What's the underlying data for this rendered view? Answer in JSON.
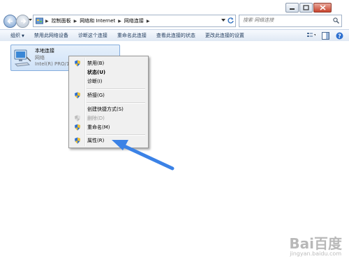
{
  "address_bar": {
    "breadcrumbs": [
      "控制面板",
      "网络和 Internet",
      "网络连接"
    ],
    "search_placeholder": "搜索 网络连接"
  },
  "toolbar": {
    "organize_label": "组织",
    "items": [
      "禁用此网络设备",
      "诊断这个连接",
      "重命名此连接",
      "查看此连接的状态",
      "更改此连接的设置"
    ]
  },
  "connection": {
    "name": "本地连接",
    "status": "网络",
    "device": "Intel(R) PRO/1"
  },
  "context_menu": {
    "items": [
      {
        "label": "禁用(B)",
        "icon": "shield-icon"
      },
      {
        "label": "状态(U)",
        "icon": "none"
      },
      {
        "label": "诊断(I)",
        "icon": "none"
      },
      {
        "label": "桥接(G)",
        "icon": "shield-icon"
      },
      {
        "label": "创建快捷方式(S)",
        "icon": "none"
      },
      {
        "label": "删除(D)",
        "icon": "shield-icon",
        "disabled": true
      },
      {
        "label": "重命名(M)",
        "icon": "shield-icon"
      },
      {
        "label": "属性(R)",
        "icon": "shield-icon"
      }
    ]
  },
  "watermark": {
    "logo": "Bai百度",
    "sub": "jingyan.baidu.com"
  },
  "colors": {
    "accent_arrow": "#3b82e6",
    "selection_bg": "#cfe2f8"
  }
}
